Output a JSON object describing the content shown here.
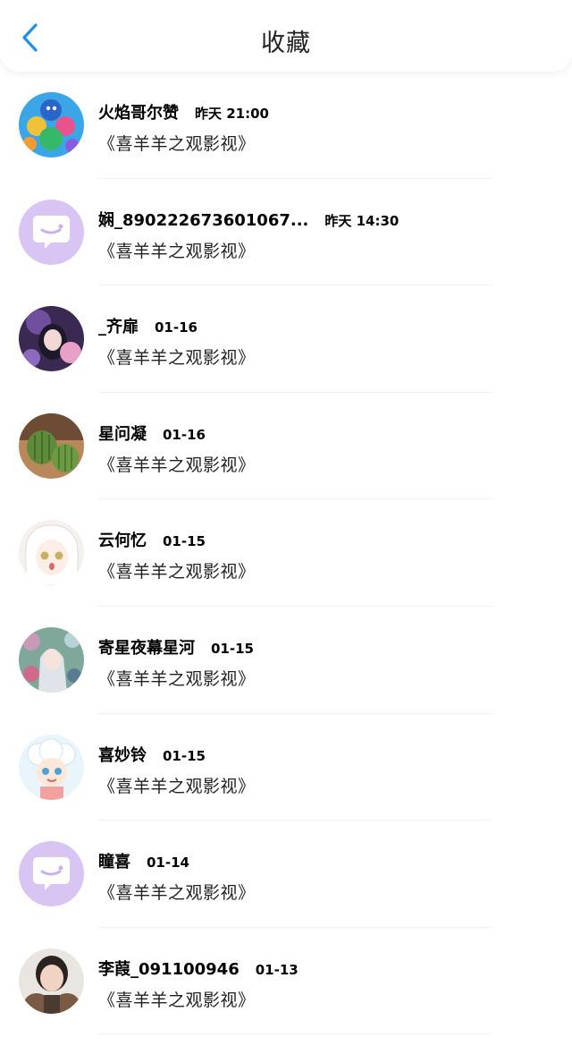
{
  "header": {
    "title": "收藏",
    "back_icon": "chevron-left-icon",
    "accent": "#1e90e8"
  },
  "items": [
    {
      "name": "火焰哥尔赞",
      "time": "昨天 21:00",
      "message": "《喜羊羊之观影视》",
      "avatar": "cartoon-heroes-avatar"
    },
    {
      "name": "娴_890222673601067...",
      "time": "昨天 14:30",
      "message": "《喜羊羊之观影视》",
      "avatar": "default-chat-avatar"
    },
    {
      "name": "_齐扉",
      "time": "01-16",
      "message": "《喜羊羊之观影视》",
      "avatar": "anime-girl-dark-avatar"
    },
    {
      "name": "星问凝",
      "time": "01-16",
      "message": "《喜羊羊之观影视》",
      "avatar": "cactus-avatar"
    },
    {
      "name": "云何忆",
      "time": "01-15",
      "message": "《喜羊羊之观影视》",
      "avatar": "anime-girl-white-avatar"
    },
    {
      "name": "寄星夜幕星河",
      "time": "01-15",
      "message": "《喜羊羊之观影视》",
      "avatar": "anime-girl-flowers-avatar"
    },
    {
      "name": "喜妙铃",
      "time": "01-15",
      "message": "《喜羊羊之观影视》",
      "avatar": "cartoon-sheep-avatar"
    },
    {
      "name": "瞳喜",
      "time": "01-14",
      "message": "《喜羊羊之观影视》",
      "avatar": "default-chat-avatar"
    },
    {
      "name": "李葭_091100946",
      "time": "01-13",
      "message": "《喜羊羊之观影视》",
      "avatar": "photo-girl-avatar"
    }
  ]
}
